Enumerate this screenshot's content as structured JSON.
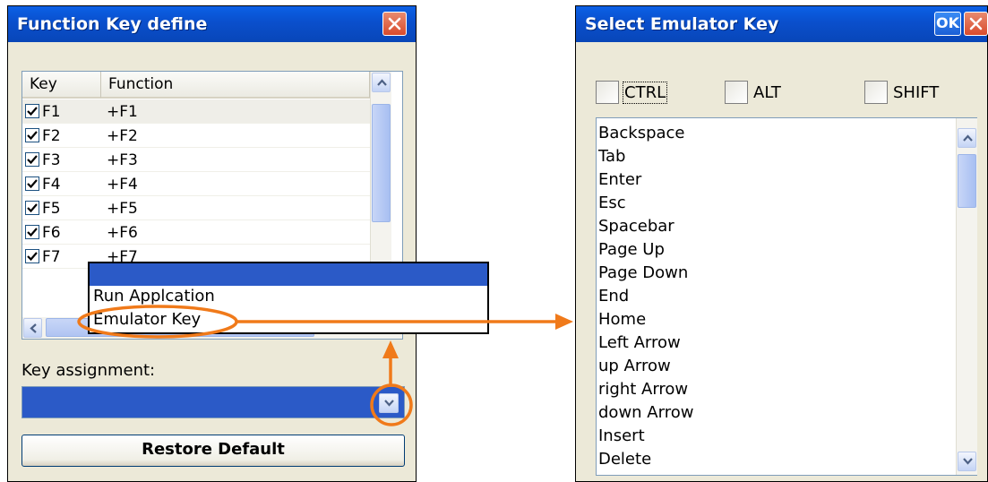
{
  "left_dialog": {
    "title": "Function Key define",
    "table": {
      "headers": [
        "Key",
        "Function"
      ],
      "rows": [
        {
          "key": "F1",
          "function": "+F1",
          "checked": true
        },
        {
          "key": "F2",
          "function": "+F2",
          "checked": true
        },
        {
          "key": "F3",
          "function": "+F3",
          "checked": true
        },
        {
          "key": "F4",
          "function": "+F4",
          "checked": true
        },
        {
          "key": "F5",
          "function": "+F5",
          "checked": true
        },
        {
          "key": "F6",
          "function": "+F6",
          "checked": true
        },
        {
          "key": "F7",
          "function": "+F7",
          "checked": true
        }
      ]
    },
    "dropdown_menu": {
      "items": [
        "",
        "Run Applcation",
        "Emulator Key"
      ],
      "selected_index": 0
    },
    "key_assignment_label": "Key assignment:",
    "key_assignment_value": "",
    "restore_default_label": "Restore Default"
  },
  "right_dialog": {
    "title": "Select Emulator Key",
    "ok_label": "OK",
    "modifiers": [
      {
        "label": "CTRL",
        "checked": false
      },
      {
        "label": "ALT",
        "checked": false
      },
      {
        "label": "SHIFT",
        "checked": false
      }
    ],
    "keys": [
      "Backspace",
      "Tab",
      "Enter",
      "Esc",
      "Spacebar",
      "Page Up",
      "Page Down",
      "End",
      "Home",
      "Left Arrow",
      "up Arrow",
      "right Arrow",
      "down Arrow",
      "Insert",
      "Delete"
    ]
  },
  "colors": {
    "annotation": "#f07a1a",
    "titlebar": "#0a4fcc",
    "selection": "#2b5ac7"
  },
  "icons": [
    "close-icon",
    "checkmark-icon",
    "chevron-up-icon",
    "chevron-down-icon",
    "chevron-left-icon"
  ]
}
